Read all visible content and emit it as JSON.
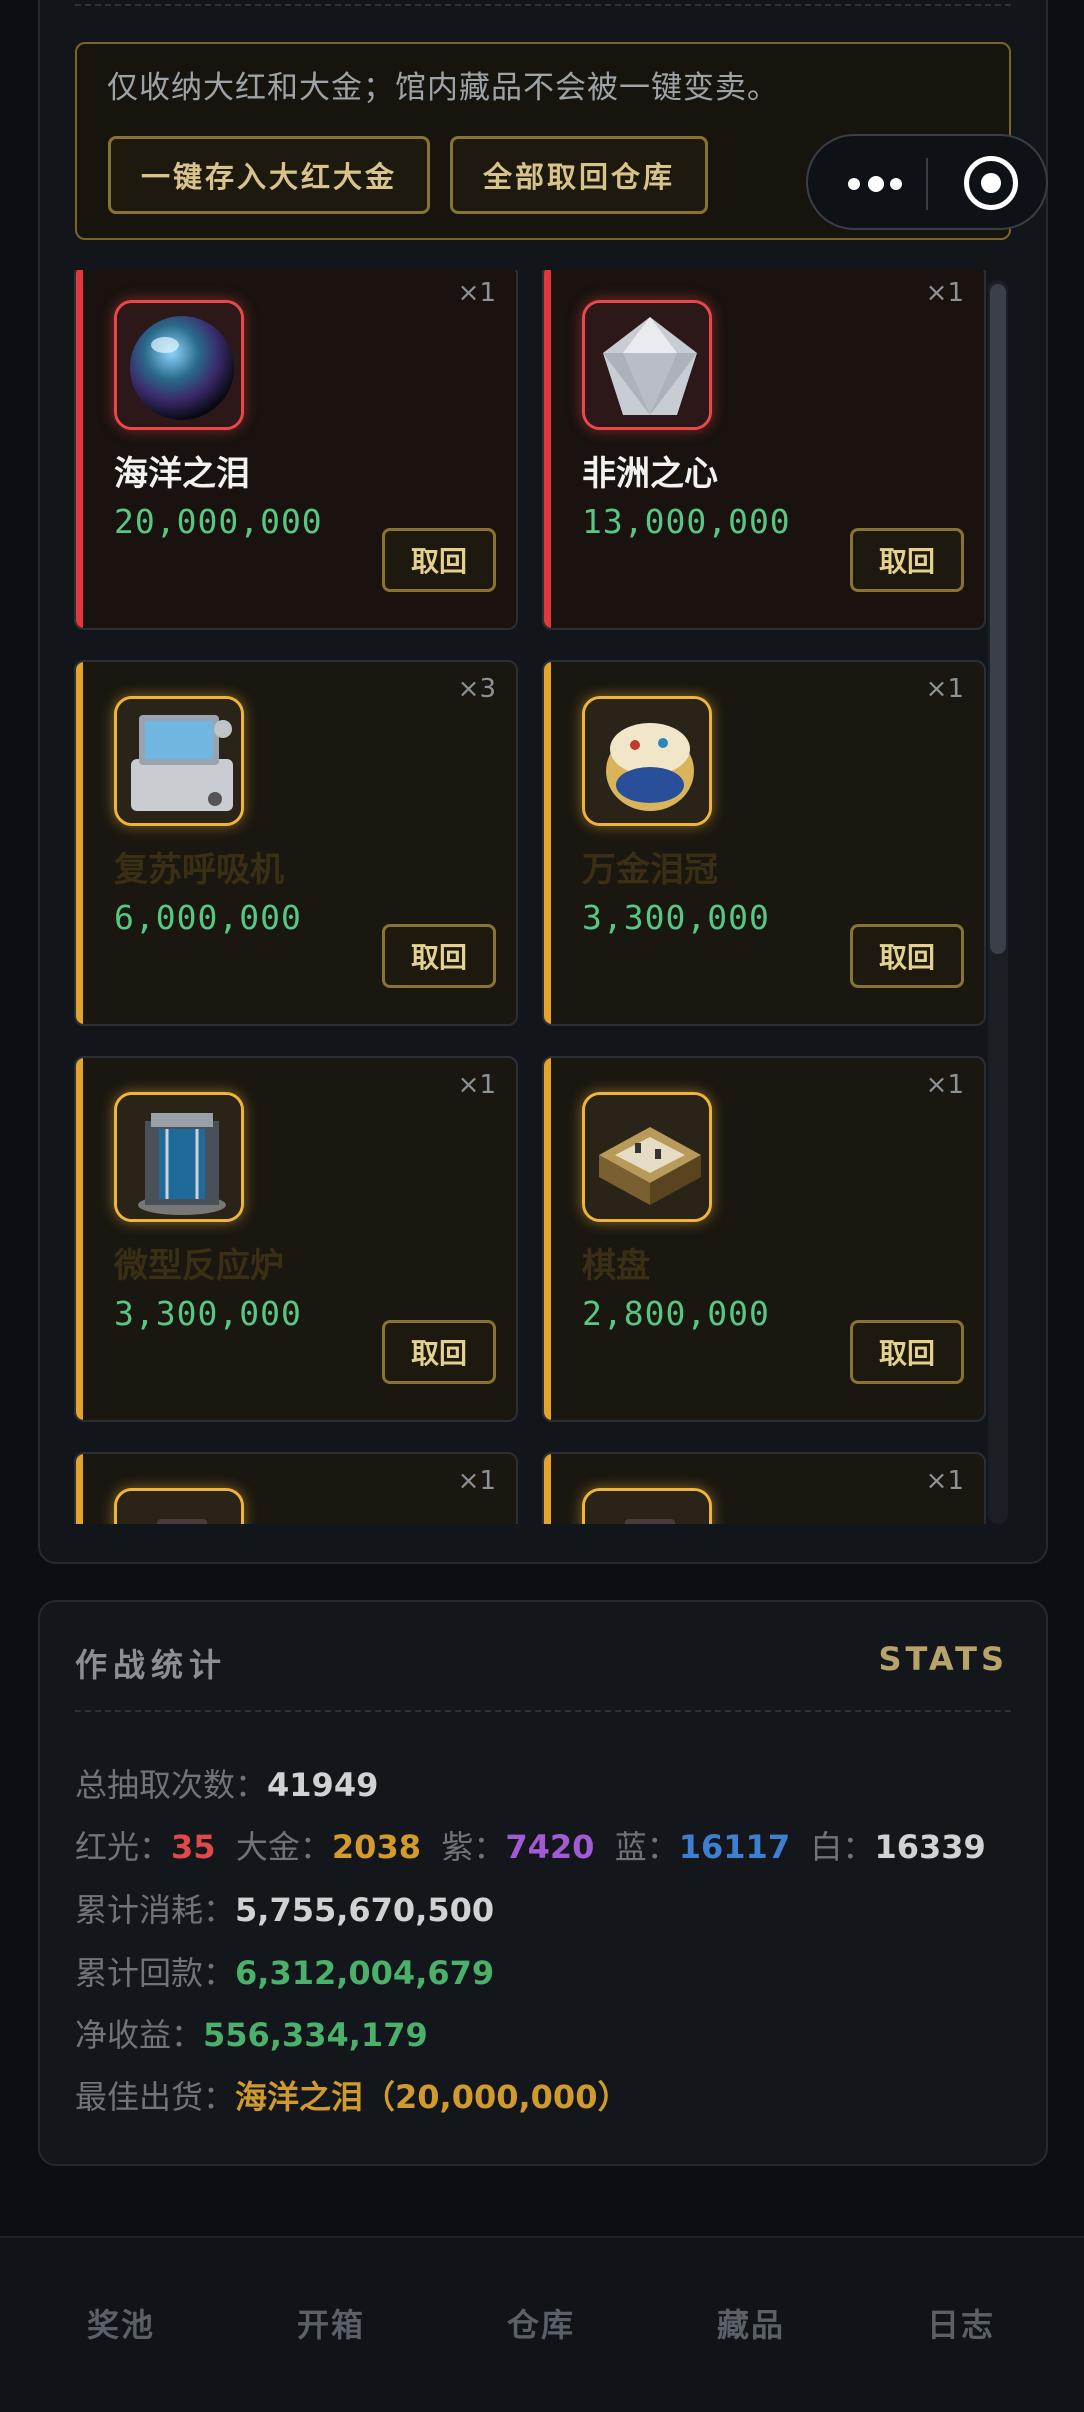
{
  "notice": {
    "text": "仅收纳大红和大金；馆内藏品不会被一键变卖。",
    "btn_store": "一键存入大红大金",
    "btn_retrieve_all": "全部取回仓库"
  },
  "items": [
    {
      "qty": "×1",
      "name": "海洋之泪",
      "value": "20,000,000",
      "action": "取回",
      "tier": "red",
      "icon": "pearl-icon"
    },
    {
      "qty": "×1",
      "name": "非洲之心",
      "value": "13,000,000",
      "action": "取回",
      "tier": "red",
      "icon": "diamond-icon"
    },
    {
      "qty": "×3",
      "name": "复苏呼吸机",
      "value": "6,000,000",
      "action": "取回",
      "tier": "gold",
      "icon": "ventilator-icon"
    },
    {
      "qty": "×1",
      "name": "万金泪冠",
      "value": "3,300,000",
      "action": "取回",
      "tier": "gold",
      "icon": "jewel-egg-icon"
    },
    {
      "qty": "×1",
      "name": "微型反应炉",
      "value": "3,300,000",
      "action": "取回",
      "tier": "gold",
      "icon": "reactor-icon"
    },
    {
      "qty": "×1",
      "name": "棋盘",
      "value": "2,800,000",
      "action": "取回",
      "tier": "gold",
      "icon": "chessboard-icon"
    },
    {
      "qty": "×1",
      "name": "",
      "value": "",
      "action": "",
      "tier": "gold",
      "icon": "case-icon"
    },
    {
      "qty": "×1",
      "name": "",
      "value": "",
      "action": "",
      "tier": "gold",
      "icon": "case-icon"
    }
  ],
  "stats": {
    "title": "作战统计",
    "title_en": "STATS",
    "total_draws_label": "总抽取次数：",
    "total_draws": "41949",
    "red_label": "红光：",
    "red": "35",
    "gold_label": "大金：",
    "gold": "2038",
    "purple_label": "紫：",
    "purple": "7420",
    "blue_label": "蓝：",
    "blue": "16117",
    "white_label": "白：",
    "white": "16339",
    "cost_label": "累计消耗：",
    "cost": "5,755,670,500",
    "return_label": "累计回款：",
    "return": "6,312,004,679",
    "net_label": "净收益：",
    "net": "556,334,179",
    "best_label": "最佳出货：",
    "best": "海洋之泪（20,000,000）"
  },
  "nav": [
    "奖池",
    "开箱",
    "仓库",
    "藏品",
    "日志"
  ],
  "colors": {
    "red_tier": "#e0383c",
    "gold_tier": "#e4a32a",
    "value_green": "#59c784",
    "accent_gold": "#d8c48a"
  }
}
